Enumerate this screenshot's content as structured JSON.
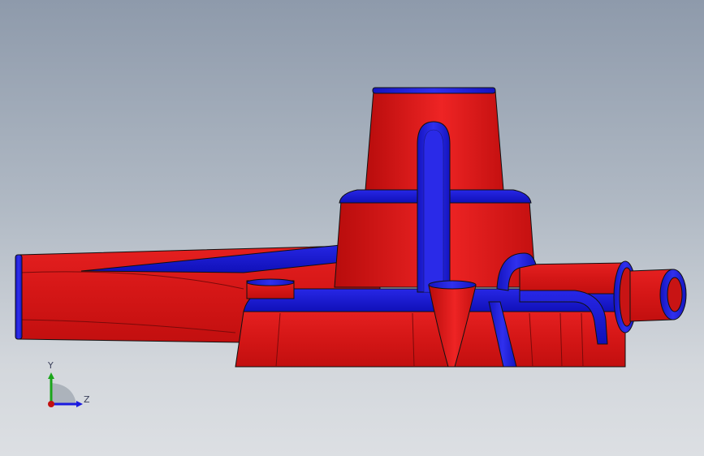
{
  "viewport": {
    "background_top": "#8e9aab",
    "background_bottom": "#dcdfe3"
  },
  "model": {
    "face_color_primary": "#e11a1a",
    "face_color_secondary": "#1a1adf",
    "edge_color": "#111111"
  },
  "triad": {
    "y_label": "Y",
    "z_label": "Z",
    "y_axis_color": "#1aa51a",
    "z_axis_color": "#1a1adf",
    "origin_color": "#c21010"
  }
}
